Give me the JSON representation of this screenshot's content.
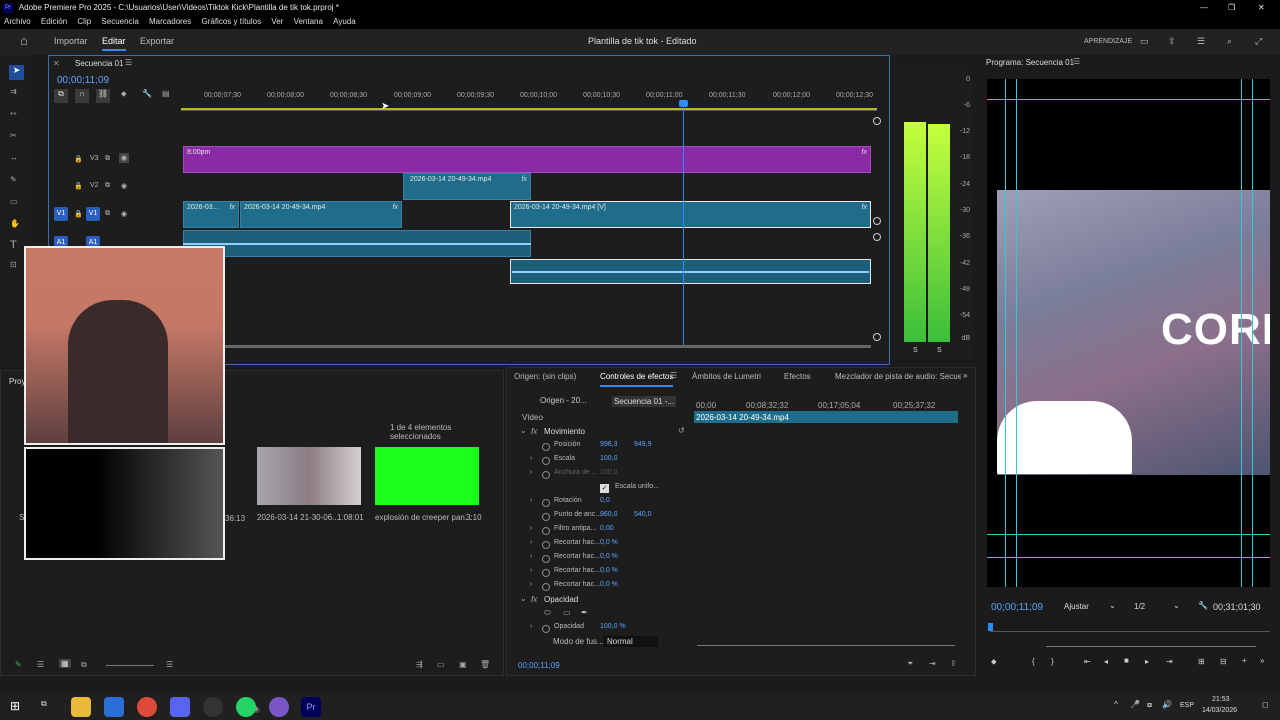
{
  "window": {
    "title": "Adobe Premiere Pro 2025 - C:\\Usuarios\\User\\Videos\\Tiktok Kick\\Plantilla de tik tok.prproj *",
    "min": "—",
    "max": "❐",
    "close": "✕"
  },
  "menu": [
    "Archivo",
    "Edición",
    "Clip",
    "Secuencia",
    "Marcadores",
    "Gráficos y títulos",
    "Ver",
    "Ventana",
    "Ayuda"
  ],
  "header": {
    "tabs": [
      "Importar",
      "Editar",
      "Exportar"
    ],
    "project_title": "Plantilla de tik tok - Editado",
    "learn": "APRENDIZAJE"
  },
  "timeline": {
    "sequence_tab": "Secuencia 01",
    "timecode": "00;00;11;09",
    "ruler": [
      "00;00;07;30",
      "00;00;08;00",
      "00;00;08;30",
      "00;00;09;00",
      "00;00;09;30",
      "00;00;10;00",
      "00;00;10;30",
      "00;00;11;00",
      "00;00;11;30",
      "00;00;12;00",
      "00;00;12;30"
    ],
    "tracks": {
      "v3": "V3",
      "v2": "V2",
      "v1": "V1",
      "a1": "A1"
    },
    "clips": {
      "v3": "8:00pm",
      "v2": "2026-03-14 20-49-34.mp4",
      "v1a": "2026-03...",
      "v1b": "2026-03-14 20-49-34.mp4",
      "v1c": "2026-03-14 20-49-34.mp4 [V]",
      "fx": "fx"
    }
  },
  "meter": {
    "scale": [
      "0",
      "-6",
      "-12",
      "-18",
      "-24",
      "-30",
      "-36",
      "-42",
      "-48",
      "-54",
      "dB"
    ],
    "s1": "S",
    "s2": "S"
  },
  "program": {
    "title": "Programa: Secuencia 01",
    "timecode": "00;00;11;09",
    "fit": "Ajustar",
    "res": "1/2",
    "duration": "00;31;01;30",
    "overlay_text": "CORRI"
  },
  "project": {
    "tab": "Proy",
    "selection": "1 de 4 elementos seleccionados",
    "items": [
      {
        "name": "2026-03-14 21-30-06...",
        "dur": "1:08:01"
      },
      {
        "name": "explosión de creeper pan...",
        "dur": "3:10"
      }
    ],
    "partial_dur": "36:13",
    "partial_letter": "Se"
  },
  "effects": {
    "tabs": [
      "Origen: (sin clips)",
      "Controles de efectos",
      "Ámbitos de Lumetri",
      "Efectos",
      "Mezclador de pista de audio: Secuencia"
    ],
    "source": "Origen - 20...",
    "sequence": "Secuencia 01 -...",
    "ruler": [
      "00;00",
      "00;08;32;32",
      "00;17;05;04",
      "00;25;37;32"
    ],
    "clip": "2026-03-14 20-49-34.mp4",
    "video": "Vídeo",
    "motion": "Movimiento",
    "rows": [
      {
        "label": "Posición",
        "v1": "996,3",
        "v2": "949,9"
      },
      {
        "label": "Escala",
        "v1": "100,0",
        "v2": ""
      },
      {
        "label": "Anchura de ...",
        "v1": "100,0",
        "v2": ""
      },
      {
        "label": "Escala unifo...",
        "v1": "",
        "v2": ""
      },
      {
        "label": "Rotación",
        "v1": "0,0",
        "v2": ""
      },
      {
        "label": "Punto de anc...",
        "v1": "960,0",
        "v2": "540,0"
      },
      {
        "label": "Filtro antipa...",
        "v1": "0,00",
        "v2": ""
      },
      {
        "label": "Recortar hac...",
        "v1": "0,0 %",
        "v2": ""
      },
      {
        "label": "Recortar hac...",
        "v1": "0,0 %",
        "v2": ""
      },
      {
        "label": "Recortar hac...",
        "v1": "0,0 %",
        "v2": ""
      },
      {
        "label": "Recortar hac...",
        "v1": "0,0 %",
        "v2": ""
      }
    ],
    "opacity": "Opacidad",
    "opacity_label": "Opacidad",
    "opacity_val": "100,0 %",
    "blend_label": "Modo de fus...",
    "blend": "Normal",
    "timecode": "00;00;11;09"
  },
  "taskbar": {
    "badge": "36",
    "lang": "ESP",
    "time": "21:53",
    "date": "14/03/2026"
  },
  "colors": {
    "accent": "#2d8cff",
    "clip_teal": "#1f6d8a",
    "clip_purple": "#8a2aa6",
    "green": "#19ff19"
  }
}
